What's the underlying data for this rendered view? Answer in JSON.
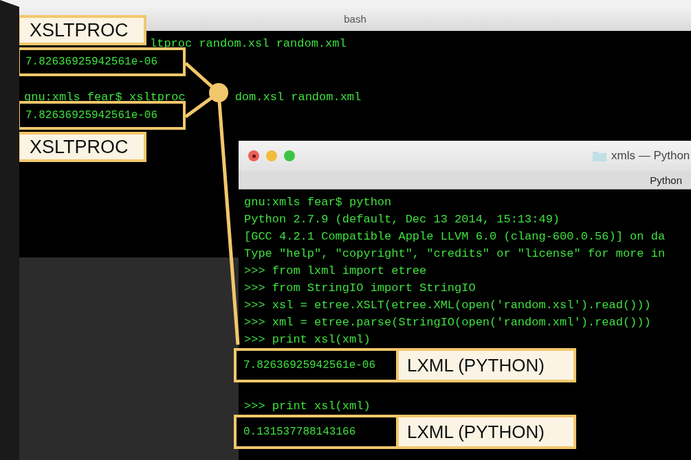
{
  "bash_window": {
    "title": "bash",
    "lines": [
      {
        "kind": "indented",
        "parts": [
          "ltproc random.xsl random.xml"
        ]
      },
      {
        "kind": "split",
        "parts": [
          "gnu:xmls fear$ xsltproc",
          "dom.xsl random.xml"
        ]
      }
    ]
  },
  "callouts": [
    {
      "kind": "label",
      "text": "XSLTPROC"
    },
    {
      "kind": "value",
      "text": "7.82636925942561e-06"
    },
    {
      "kind": "value",
      "text": "7.82636925942561e-06"
    },
    {
      "kind": "label",
      "text": "XSLTPROC"
    }
  ],
  "python_window": {
    "title": "xmls — Python",
    "tab": "Python",
    "lines": [
      "gnu:xmls fear$ python",
      "Python 2.7.9 (default, Dec 13 2014, 15:13:49)",
      "[GCC 4.2.1 Compatible Apple LLVM 6.0 (clang-600.0.56)] on da",
      "Type \"help\", \"copyright\", \"credits\" or \"license\" for more in",
      ">>> from lxml import etree",
      ">>> from StringIO import StringIO",
      ">>> xsl = etree.XSLT(etree.XML(open('random.xsl').read()))",
      ">>> xml = etree.parse(StringIO(open('random.xml').read()))"
    ],
    "results": [
      {
        "prompt": ">>> print xsl(xml)",
        "value": "7.82636925942561e-06",
        "label": "LXML (PYTHON)"
      },
      {
        "prompt": ">>> print xsl(xml)",
        "value": "0.131537788143166",
        "label": "LXML (PYTHON)"
      }
    ]
  }
}
